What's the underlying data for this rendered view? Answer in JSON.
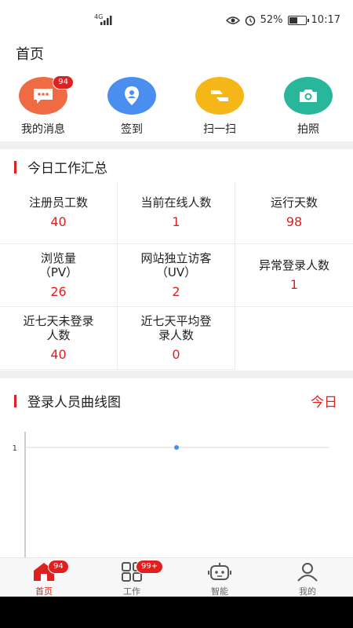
{
  "status_bar": {
    "network": "4G",
    "battery": "52%",
    "battery_level": 0.52,
    "time": "10:17"
  },
  "page_title": "首页",
  "quick_actions": [
    {
      "label": "我的消息",
      "icon": "message-icon",
      "color": "#ef6b44",
      "badge": "94"
    },
    {
      "label": "签到",
      "icon": "location-pin-icon",
      "color": "#4a8ef0"
    },
    {
      "label": "扫一扫",
      "icon": "scan-icon",
      "color": "#f5b618"
    },
    {
      "label": "拍照",
      "icon": "camera-icon",
      "color": "#28b79b"
    }
  ],
  "summary": {
    "title": "今日工作汇总",
    "cells": [
      {
        "label": "注册员工数",
        "value": "40"
      },
      {
        "label": "当前在线人数",
        "value": "1"
      },
      {
        "label": "运行天数",
        "value": "98"
      },
      {
        "label": "浏览量（PV）",
        "value": "26"
      },
      {
        "label": "网站独立访客（UV）",
        "value": "2"
      },
      {
        "label": "异常登录人数",
        "value": "1"
      },
      {
        "label": "近七天未登录人数",
        "value": "40"
      },
      {
        "label": "近七天平均登录人数",
        "value": "0"
      }
    ]
  },
  "login_chart": {
    "title": "登录人员曲线图",
    "range_link": "今日"
  },
  "chart_data": {
    "type": "line",
    "title": "",
    "x": [
      0
    ],
    "series": [
      {
        "values": [
          1
        ]
      }
    ],
    "ytick_labels": [
      "1"
    ],
    "grid": true,
    "color": "#4a8ef0"
  },
  "tabbar": {
    "items": [
      {
        "label": "首页",
        "icon": "home-icon",
        "badge": "94",
        "active": true
      },
      {
        "label": "工作",
        "icon": "grid-icon",
        "badge": "99+"
      },
      {
        "label": "智能",
        "icon": "robot-icon"
      },
      {
        "label": "我的",
        "icon": "user-icon"
      }
    ]
  },
  "colors": {
    "accent": "#e02020",
    "divider": "#f0f0f0"
  }
}
